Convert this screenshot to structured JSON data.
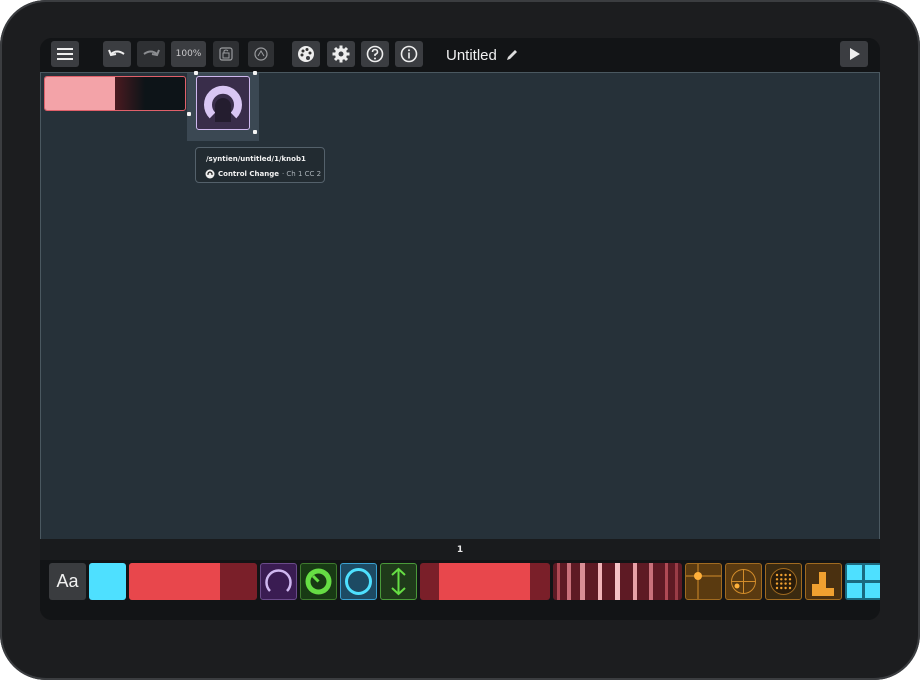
{
  "toolbar": {
    "zoom_label": "100%",
    "title": "Untitled"
  },
  "tooltip": {
    "path": "/syntien/untitled/1/knob1",
    "type": "Control Change",
    "details": "· Ch 1 CC 2"
  },
  "page_indicator": "1",
  "palette": {
    "text_widget_label": "Aa"
  },
  "colors": {
    "canvas": "#263139",
    "fader_red": "#f3a3a8",
    "knob_purple": "#cfb8ef",
    "palette_red": "#e8474c",
    "palette_green": "#66dd44",
    "palette_cyan": "#4ee0ff",
    "palette_gold": "#f0a030"
  }
}
